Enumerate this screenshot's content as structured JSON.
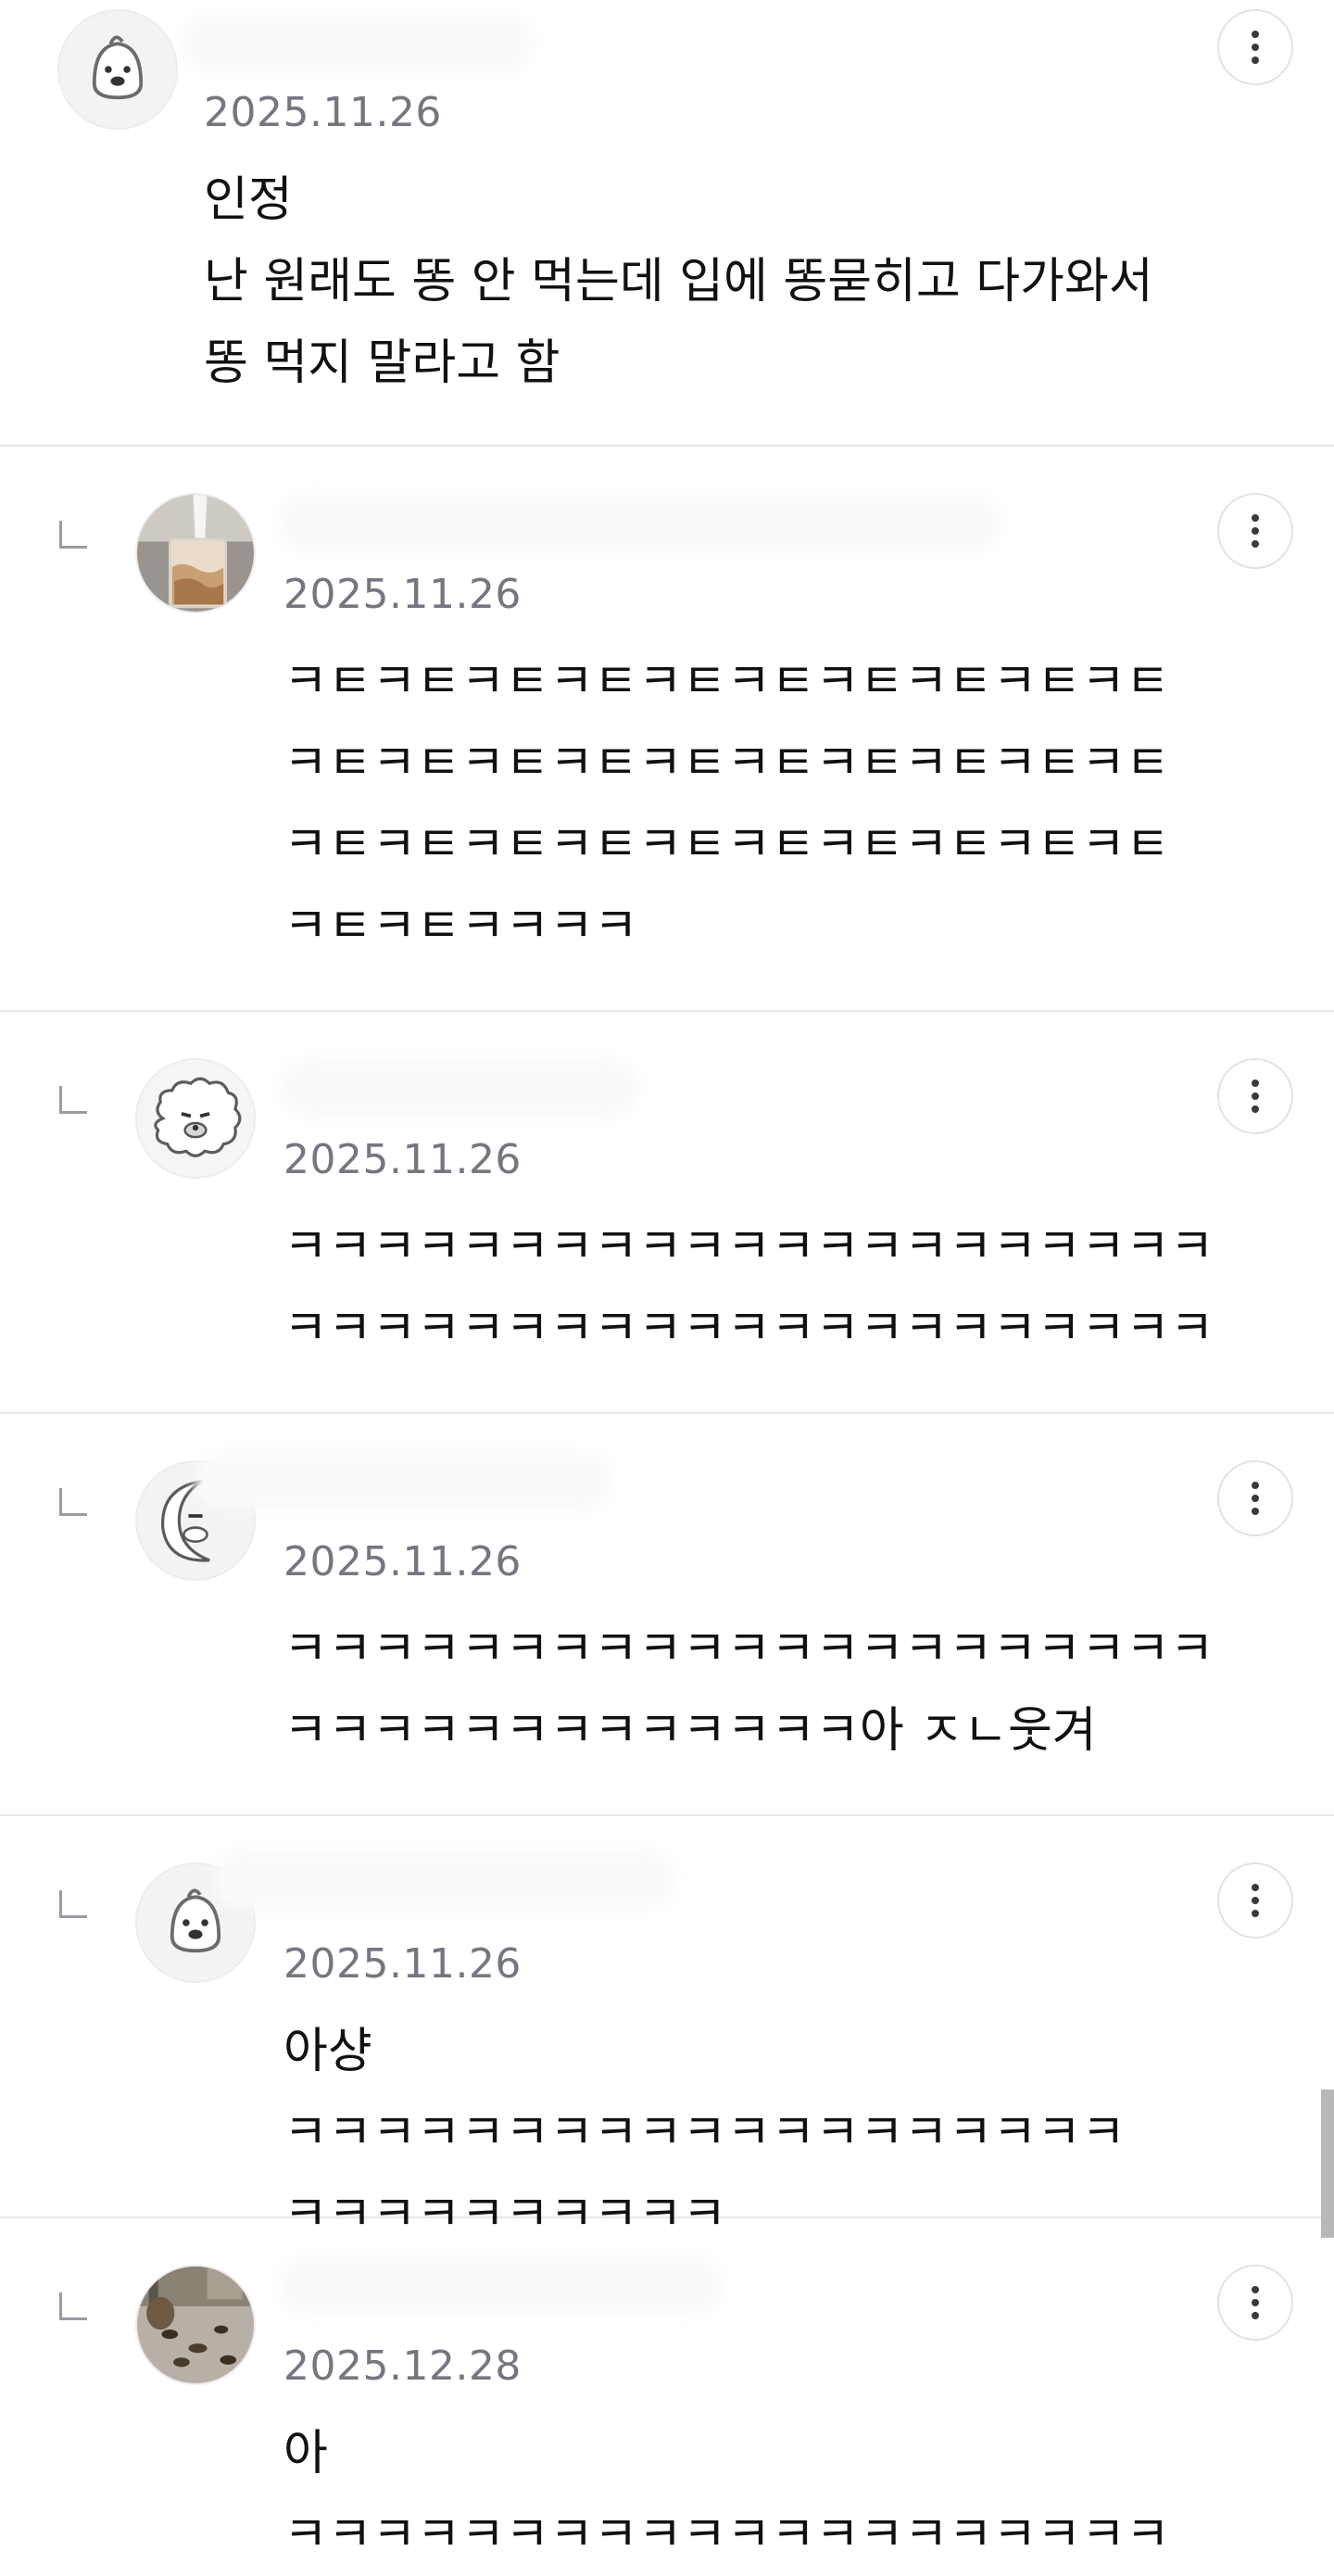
{
  "comments": [
    {
      "date": "2025.11.26",
      "text": "인정\n난 원래도 똥 안 먹는데 입에 똥묻히고 다가와서\n똥 먹지 말라고 함",
      "avatar_icon": "cartoon-face-icon",
      "is_reply": false
    },
    {
      "date": "2025.11.26",
      "text": "ㅋㅌㅋㅌㅋㅌㅋㅌㅋㅌㅋㅌㅋㅌㅋㅌㅋㅌㅋㅌ\nㅋㅌㅋㅌㅋㅌㅋㅌㅋㅌㅋㅌㅋㅌㅋㅌㅋㅌㅋㅌ\nㅋㅌㅋㅌㅋㅌㅋㅌㅋㅌㅋㅌㅋㅌㅋㅌㅋㅌㅋㅌ\nㅋㅌㅋㅌㅋㅋㅋㅋ",
      "avatar_icon": "milk-tea-photo-icon",
      "is_reply": true
    },
    {
      "date": "2025.11.26",
      "text": "ㅋㅋㅋㅋㅋㅋㅋㅋㅋㅋㅋㅋㅋㅋㅋㅋㅋㅋㅋㅋㅋ\nㅋㅋㅋㅋㅋㅋㅋㅋㅋㅋㅋㅋㅋㅋㅋㅋㅋㅋㅋㅋㅋ",
      "avatar_icon": "sheep-face-icon",
      "is_reply": true
    },
    {
      "date": "2025.11.26",
      "text": "ㅋㅋㅋㅋㅋㅋㅋㅋㅋㅋㅋㅋㅋㅋㅋㅋㅋㅋㅋㅋㅋ\nㅋㅋㅋㅋㅋㅋㅋㅋㅋㅋㅋㅋㅋ아 ㅈㄴ웃겨",
      "avatar_icon": "moon-face-icon",
      "is_reply": true
    },
    {
      "date": "2025.11.26",
      "text": "아샹 ㅋㅋㅋㅋㅋㅋㅋㅋㅋㅋㅋㅋㅋㅋㅋㅋㅋㅋㅋ\nㅋㅋㅋㅋㅋㅋㅋㅋㅋㅋ",
      "avatar_icon": "cartoon-face-icon",
      "is_reply": true
    },
    {
      "date": "2025.12.28",
      "text": "아 ㅋㅋㅋㅋㅋㅋㅋㅋㅋㅋㅋㅋㅋㅋㅋㅋㅋㅋㅋㅋ",
      "avatar_icon": "birds-photo-icon",
      "is_reply": true
    }
  ]
}
